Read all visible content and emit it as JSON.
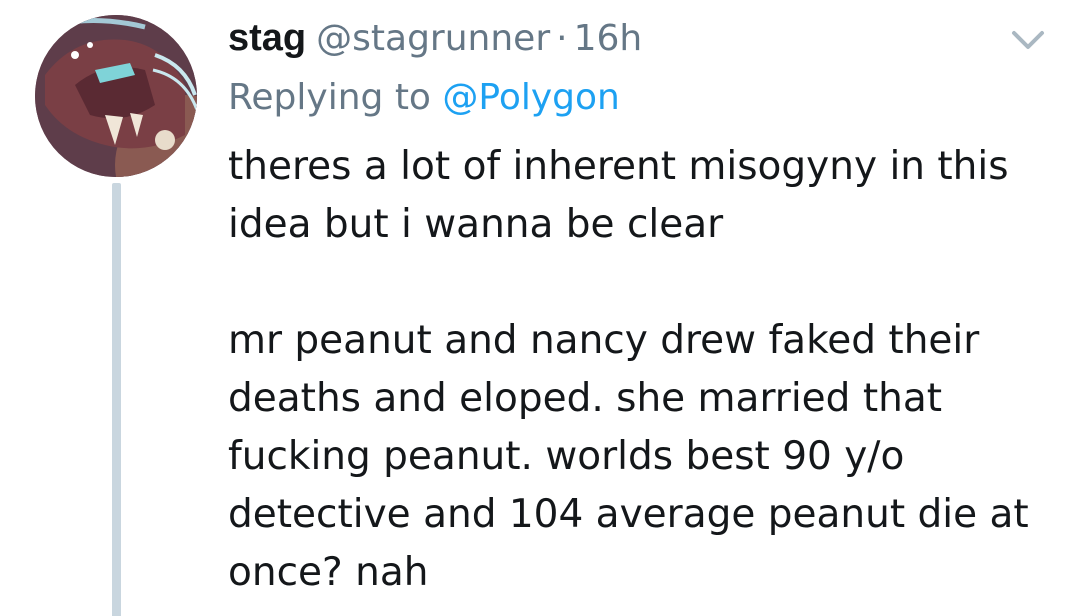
{
  "tweet": {
    "display_name": "stag",
    "handle": "@stagrunner",
    "separator": "·",
    "time": "16h",
    "replying_to_prefix": "Replying to",
    "replying_to_handle": "@Polygon",
    "paragraph_1": "theres a lot of inherent misogyny in this idea but i wanna be clear",
    "paragraph_2": "mr peanut and nancy drew faked their deaths and eloped. she married that fucking peanut. worlds best 90 y/o detective and 104 average peanut die at once? nah"
  },
  "icons": {
    "avatar": "avatar-illustration",
    "menu": "chevron-down-icon"
  },
  "colors": {
    "text": "#14171a",
    "secondary": "#657786",
    "link": "#1da1f2",
    "thread_line": "#c9d6df"
  }
}
